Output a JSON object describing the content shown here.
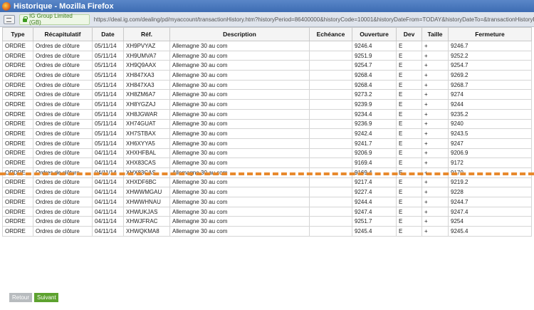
{
  "window": {
    "title": "Historique - Mozilla Firefox"
  },
  "addressbar": {
    "identity": "IG Group Limited (GB)",
    "url": "https://deal.ig.com/dealing/pd/myaccount/transactionHistory.htm?historyPeriod=86400000&historyCode=10001&historyDateFrom=TODAY&historyDateTo=&transactionHistoryPageN..."
  },
  "table": {
    "headers": [
      "Type",
      "Récapitulatif",
      "Date",
      "Réf.",
      "Description",
      "Echéance",
      "Ouverture",
      "Dev",
      "Taille",
      "Fermeture"
    ],
    "rows": [
      {
        "type": "ORDRE",
        "recap": "Ordres de clôture",
        "date": "05/11/14",
        "ref": "XH9PVYAZ",
        "desc": "Allemagne 30 au com",
        "ech": "",
        "ouv": "9246.4",
        "dev": "E",
        "taille": "+",
        "ferm": "9246.7"
      },
      {
        "type": "ORDRE",
        "recap": "Ordres de clôture",
        "date": "05/11/14",
        "ref": "XH9UMVA7",
        "desc": "Allemagne 30 au com",
        "ech": "",
        "ouv": "9251.9",
        "dev": "E",
        "taille": "+",
        "ferm": "9252.2"
      },
      {
        "type": "ORDRE",
        "recap": "Ordres de clôture",
        "date": "05/11/14",
        "ref": "XH9Q9AAX",
        "desc": "Allemagne 30 au com",
        "ech": "",
        "ouv": "9254.7",
        "dev": "E",
        "taille": "+",
        "ferm": "9254.7"
      },
      {
        "type": "ORDRE",
        "recap": "Ordres de clôture",
        "date": "05/11/14",
        "ref": "XH847XA3",
        "desc": "Allemagne 30 au com",
        "ech": "",
        "ouv": "9268.4",
        "dev": "E",
        "taille": "+",
        "ferm": "9269.2"
      },
      {
        "type": "ORDRE",
        "recap": "Ordres de clôture",
        "date": "05/11/14",
        "ref": "XH847XA3",
        "desc": "Allemagne 30 au com",
        "ech": "",
        "ouv": "9268.4",
        "dev": "E",
        "taille": "+",
        "ferm": "9268.7"
      },
      {
        "type": "ORDRE",
        "recap": "Ordres de clôture",
        "date": "05/11/14",
        "ref": "XH8ZM6A7",
        "desc": "Allemagne 30 au com",
        "ech": "",
        "ouv": "9273.2",
        "dev": "E",
        "taille": "+",
        "ferm": "9274"
      },
      {
        "type": "ORDRE",
        "recap": "Ordres de clôture",
        "date": "05/11/14",
        "ref": "XH8YGZAJ",
        "desc": "Allemagne 30 au com",
        "ech": "",
        "ouv": "9239.9",
        "dev": "E",
        "taille": "+",
        "ferm": "9244"
      },
      {
        "type": "ORDRE",
        "recap": "Ordres de clôture",
        "date": "05/11/14",
        "ref": "XH8JGWAR",
        "desc": "Allemagne 30 au com",
        "ech": "",
        "ouv": "9234.4",
        "dev": "E",
        "taille": "+",
        "ferm": "9235.2"
      },
      {
        "type": "ORDRE",
        "recap": "Ordres de clôture",
        "date": "05/11/14",
        "ref": "XH74GUAT",
        "desc": "Allemagne 30 au com",
        "ech": "",
        "ouv": "9236.9",
        "dev": "E",
        "taille": "+",
        "ferm": "9240"
      },
      {
        "type": "ORDRE",
        "recap": "Ordres de clôture",
        "date": "05/11/14",
        "ref": "XH7STBAX",
        "desc": "Allemagne 30 au com",
        "ech": "",
        "ouv": "9242.4",
        "dev": "E",
        "taille": "+",
        "ferm": "9243.5"
      },
      {
        "type": "ORDRE",
        "recap": "Ordres de clôture",
        "date": "05/11/14",
        "ref": "XH6XYYA5",
        "desc": "Allemagne 30 au com",
        "ech": "",
        "ouv": "9241.7",
        "dev": "E",
        "taille": "+",
        "ferm": "9247"
      },
      {
        "type": "ORDRE",
        "recap": "Ordres de clôture",
        "date": "04/11/14",
        "ref": "XHXHFBAL",
        "desc": "Allemagne 30 au com",
        "ech": "",
        "ouv": "9206.9",
        "dev": "E",
        "taille": "+",
        "ferm": "9206.9"
      },
      {
        "type": "ORDRE",
        "recap": "Ordres de clôture",
        "date": "04/11/14",
        "ref": "XHX83CAS",
        "desc": "Allemagne 30 au com",
        "ech": "",
        "ouv": "9169.4",
        "dev": "E",
        "taille": "+",
        "ferm": "9172"
      },
      {
        "type": "ORDRE",
        "recap": "Ordres de clôture",
        "date": "04/11/14",
        "ref": "XHX83CAS",
        "desc": "Allemagne 30 au com",
        "ech": "",
        "ouv": "9169.4",
        "dev": "E",
        "taille": "+",
        "ferm": "9170"
      },
      {
        "type": "ORDRE",
        "recap": "Ordres de clôture",
        "date": "04/11/14",
        "ref": "XHXDF6BC",
        "desc": "Allemagne 30 au com",
        "ech": "",
        "ouv": "9217.4",
        "dev": "E",
        "taille": "+",
        "ferm": "9219.2"
      },
      {
        "type": "ORDRE",
        "recap": "Ordres de clôture",
        "date": "04/11/14",
        "ref": "XHWWMGAU",
        "desc": "Allemagne 30 au com",
        "ech": "",
        "ouv": "9227.4",
        "dev": "E",
        "taille": "+",
        "ferm": "9228"
      },
      {
        "type": "ORDRE",
        "recap": "Ordres de clôture",
        "date": "04/11/14",
        "ref": "XHWWHNAU",
        "desc": "Allemagne 30 au com",
        "ech": "",
        "ouv": "9244.4",
        "dev": "E",
        "taille": "+",
        "ferm": "9244.7"
      },
      {
        "type": "ORDRE",
        "recap": "Ordres de clôture",
        "date": "04/11/14",
        "ref": "XHWUKJAS",
        "desc": "Allemagne 30 au com",
        "ech": "",
        "ouv": "9247.4",
        "dev": "E",
        "taille": "+",
        "ferm": "9247.4"
      },
      {
        "type": "ORDRE",
        "recap": "Ordres de clôture",
        "date": "04/11/14",
        "ref": "XHWJFRAC",
        "desc": "Allemagne 30 au com",
        "ech": "",
        "ouv": "9251.7",
        "dev": "E",
        "taille": "+",
        "ferm": "9254"
      },
      {
        "type": "ORDRE",
        "recap": "Ordres de clôture",
        "date": "04/11/14",
        "ref": "XHWQKMA8",
        "desc": "Allemagne 30 au com",
        "ech": "",
        "ouv": "9245.4",
        "dev": "E",
        "taille": "+",
        "ferm": "9245.4"
      }
    ]
  },
  "pagination": {
    "back_label": "Retour",
    "next_label": "Suivant"
  },
  "colors": {
    "annotation_dash": "#e8892d",
    "next_button": "#5da22f",
    "back_button": "#b8bcbf"
  }
}
